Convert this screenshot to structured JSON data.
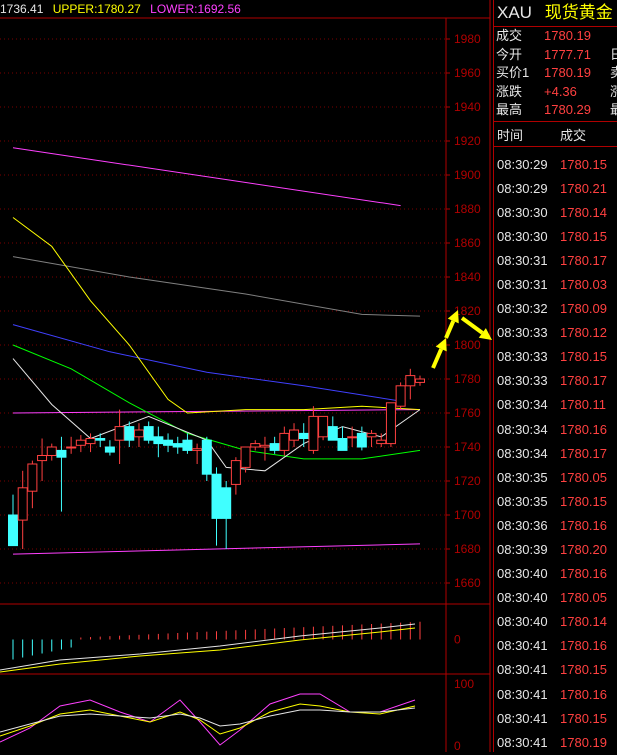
{
  "header": {
    "mid_label": "1736.41",
    "upper_label": "UPPER:1780.27",
    "lower_label": "LOWER:1692.56",
    "colors": {
      "mid": "#e6e6e6",
      "upper": "#ffff00",
      "lower": "#ff40ff"
    }
  },
  "symbol": {
    "code": "XAU",
    "name": "现货黄金"
  },
  "quote": [
    {
      "label": "成交",
      "value": "1780.19",
      "cut": ""
    },
    {
      "label": "今开",
      "value": "1777.71",
      "cut": "日"
    },
    {
      "label": "买价1",
      "value": "1780.19",
      "cut": "卖"
    },
    {
      "label": "涨跌",
      "value": "+4.36",
      "cut": "涨"
    },
    {
      "label": "最高",
      "value": "1780.29",
      "cut": "最"
    }
  ],
  "ticks_header": {
    "time": "时间",
    "price": "成交"
  },
  "ticks": [
    {
      "time": "08:30:29",
      "price": "1780.15"
    },
    {
      "time": "08:30:29",
      "price": "1780.21"
    },
    {
      "time": "08:30:30",
      "price": "1780.14"
    },
    {
      "time": "08:30:30",
      "price": "1780.15"
    },
    {
      "time": "08:30:31",
      "price": "1780.17"
    },
    {
      "time": "08:30:31",
      "price": "1780.03"
    },
    {
      "time": "08:30:32",
      "price": "1780.09"
    },
    {
      "time": "08:30:33",
      "price": "1780.12"
    },
    {
      "time": "08:30:33",
      "price": "1780.15"
    },
    {
      "time": "08:30:33",
      "price": "1780.17"
    },
    {
      "time": "08:30:34",
      "price": "1780.11"
    },
    {
      "time": "08:30:34",
      "price": "1780.16"
    },
    {
      "time": "08:30:34",
      "price": "1780.17"
    },
    {
      "time": "08:30:35",
      "price": "1780.05"
    },
    {
      "time": "08:30:35",
      "price": "1780.15"
    },
    {
      "time": "08:30:36",
      "price": "1780.16"
    },
    {
      "time": "08:30:39",
      "price": "1780.20"
    },
    {
      "time": "08:30:40",
      "price": "1780.16"
    },
    {
      "time": "08:30:40",
      "price": "1780.05"
    },
    {
      "time": "08:30:40",
      "price": "1780.14"
    },
    {
      "time": "08:30:41",
      "price": "1780.16"
    },
    {
      "time": "08:30:41",
      "price": "1780.15"
    },
    {
      "time": "08:30:41",
      "price": "1780.16"
    },
    {
      "time": "08:30:41",
      "price": "1780.15"
    },
    {
      "time": "08:30:41",
      "price": "1780.19"
    }
  ],
  "chart_data": [
    {
      "type": "candlestick",
      "title": "",
      "ylim": [
        1650,
        1990
      ],
      "yticks": [
        1980,
        1960,
        1940,
        1920,
        1900,
        1880,
        1860,
        1840,
        1820,
        1800,
        1780,
        1760,
        1740,
        1720,
        1700,
        1680,
        1660
      ],
      "grid": true,
      "candles": [
        {
          "o": 1700,
          "h": 1712,
          "l": 1682,
          "c": 1682
        },
        {
          "o": 1697,
          "h": 1726,
          "l": 1680,
          "c": 1716
        },
        {
          "o": 1714,
          "h": 1732,
          "l": 1704,
          "c": 1730
        },
        {
          "o": 1732,
          "h": 1745,
          "l": 1720,
          "c": 1735
        },
        {
          "o": 1735,
          "h": 1742,
          "l": 1732,
          "c": 1740
        },
        {
          "o": 1738,
          "h": 1746,
          "l": 1702,
          "c": 1734
        },
        {
          "o": 1740,
          "h": 1746,
          "l": 1736,
          "c": 1740
        },
        {
          "o": 1741,
          "h": 1747,
          "l": 1737,
          "c": 1744
        },
        {
          "o": 1742,
          "h": 1748,
          "l": 1737,
          "c": 1745
        },
        {
          "o": 1745,
          "h": 1748,
          "l": 1740,
          "c": 1744
        },
        {
          "o": 1740,
          "h": 1744,
          "l": 1735,
          "c": 1737
        },
        {
          "o": 1744,
          "h": 1762,
          "l": 1730,
          "c": 1752
        },
        {
          "o": 1752,
          "h": 1755,
          "l": 1740,
          "c": 1744
        },
        {
          "o": 1746,
          "h": 1754,
          "l": 1740,
          "c": 1750
        },
        {
          "o": 1752,
          "h": 1755,
          "l": 1742,
          "c": 1744
        },
        {
          "o": 1746,
          "h": 1752,
          "l": 1734,
          "c": 1742
        },
        {
          "o": 1744,
          "h": 1748,
          "l": 1737,
          "c": 1741
        },
        {
          "o": 1742,
          "h": 1746,
          "l": 1736,
          "c": 1740
        },
        {
          "o": 1744,
          "h": 1748,
          "l": 1736,
          "c": 1738
        },
        {
          "o": 1738,
          "h": 1742,
          "l": 1730,
          "c": 1739
        },
        {
          "o": 1744,
          "h": 1746,
          "l": 1720,
          "c": 1724
        },
        {
          "o": 1724,
          "h": 1728,
          "l": 1682,
          "c": 1698
        },
        {
          "o": 1716,
          "h": 1720,
          "l": 1680,
          "c": 1698
        },
        {
          "o": 1718,
          "h": 1734,
          "l": 1712,
          "c": 1732
        },
        {
          "o": 1728,
          "h": 1740,
          "l": 1725,
          "c": 1740
        },
        {
          "o": 1740,
          "h": 1744,
          "l": 1738,
          "c": 1742
        },
        {
          "o": 1740,
          "h": 1746,
          "l": 1732,
          "c": 1741
        },
        {
          "o": 1742,
          "h": 1746,
          "l": 1736,
          "c": 1738
        },
        {
          "o": 1738,
          "h": 1752,
          "l": 1735,
          "c": 1748
        },
        {
          "o": 1744,
          "h": 1754,
          "l": 1740,
          "c": 1750
        },
        {
          "o": 1748,
          "h": 1754,
          "l": 1740,
          "c": 1745
        },
        {
          "o": 1738,
          "h": 1764,
          "l": 1736,
          "c": 1758
        },
        {
          "o": 1746,
          "h": 1758,
          "l": 1744,
          "c": 1758
        },
        {
          "o": 1752,
          "h": 1758,
          "l": 1744,
          "c": 1744
        },
        {
          "o": 1745,
          "h": 1752,
          "l": 1738,
          "c": 1738
        },
        {
          "o": 1746,
          "h": 1752,
          "l": 1740,
          "c": 1746
        },
        {
          "o": 1748,
          "h": 1752,
          "l": 1738,
          "c": 1740
        },
        {
          "o": 1746,
          "h": 1750,
          "l": 1740,
          "c": 1748
        },
        {
          "o": 1742,
          "h": 1748,
          "l": 1740,
          "c": 1744
        },
        {
          "o": 1742,
          "h": 1766,
          "l": 1740,
          "c": 1766
        },
        {
          "o": 1764,
          "h": 1778,
          "l": 1762,
          "c": 1776
        },
        {
          "o": 1776,
          "h": 1786,
          "l": 1768,
          "c": 1782
        },
        {
          "o": 1778,
          "h": 1782,
          "l": 1776,
          "c": 1780
        }
      ],
      "lines": [
        {
          "color": "#ff40ff",
          "values": [
            [
              0,
              1916
            ],
            [
              40,
              1882
            ]
          ]
        },
        {
          "color": "#ff40ff",
          "values": [
            [
              0,
              1760
            ],
            [
              42,
              1762
            ]
          ]
        },
        {
          "color": "#ff40ff",
          "values": [
            [
              0,
              1677
            ],
            [
              42,
              1683
            ]
          ]
        },
        {
          "color": "#4040ff",
          "values": [
            [
              0,
              1812
            ],
            [
              10,
              1796
            ],
            [
              20,
              1784
            ],
            [
              30,
              1776
            ],
            [
              40,
              1767
            ]
          ]
        },
        {
          "color": "#808080",
          "values": [
            [
              0,
              1852
            ],
            [
              12,
              1840
            ],
            [
              24,
              1830
            ],
            [
              36,
              1818
            ],
            [
              42,
              1817
            ]
          ]
        },
        {
          "color": "#ffff00",
          "values": [
            [
              0,
              1875
            ],
            [
              4,
              1858
            ],
            [
              8,
              1826
            ],
            [
              12,
              1800
            ],
            [
              16,
              1768
            ],
            [
              18,
              1760
            ],
            [
              24,
              1762
            ],
            [
              30,
              1762
            ],
            [
              36,
              1764
            ],
            [
              42,
              1762
            ]
          ]
        },
        {
          "color": "#00ff00",
          "values": [
            [
              0,
              1800
            ],
            [
              6,
              1786
            ],
            [
              12,
              1766
            ],
            [
              18,
              1748
            ],
            [
              24,
              1738
            ],
            [
              30,
              1733
            ],
            [
              36,
              1733
            ],
            [
              42,
              1738
            ]
          ]
        },
        {
          "color": "#e6e6e6",
          "values": [
            [
              0,
              1792
            ],
            [
              4,
              1765
            ],
            [
              8,
              1745
            ],
            [
              14,
              1758
            ],
            [
              20,
              1744
            ],
            [
              22,
              1728
            ],
            [
              26,
              1726
            ],
            [
              30,
              1742
            ],
            [
              34,
              1752
            ],
            [
              38,
              1746
            ],
            [
              42,
              1762
            ]
          ]
        }
      ]
    },
    {
      "type": "bar",
      "title": "",
      "ylim": [
        -20,
        20
      ],
      "yticks": [
        0
      ],
      "note": "histogram subpanel"
    },
    {
      "type": "line",
      "title": "",
      "ylim": [
        0,
        110
      ],
      "yticks": [
        100
      ],
      "series_colors": [
        "#ff40ff",
        "#ffff00",
        "#e6e6e6"
      ]
    }
  ]
}
